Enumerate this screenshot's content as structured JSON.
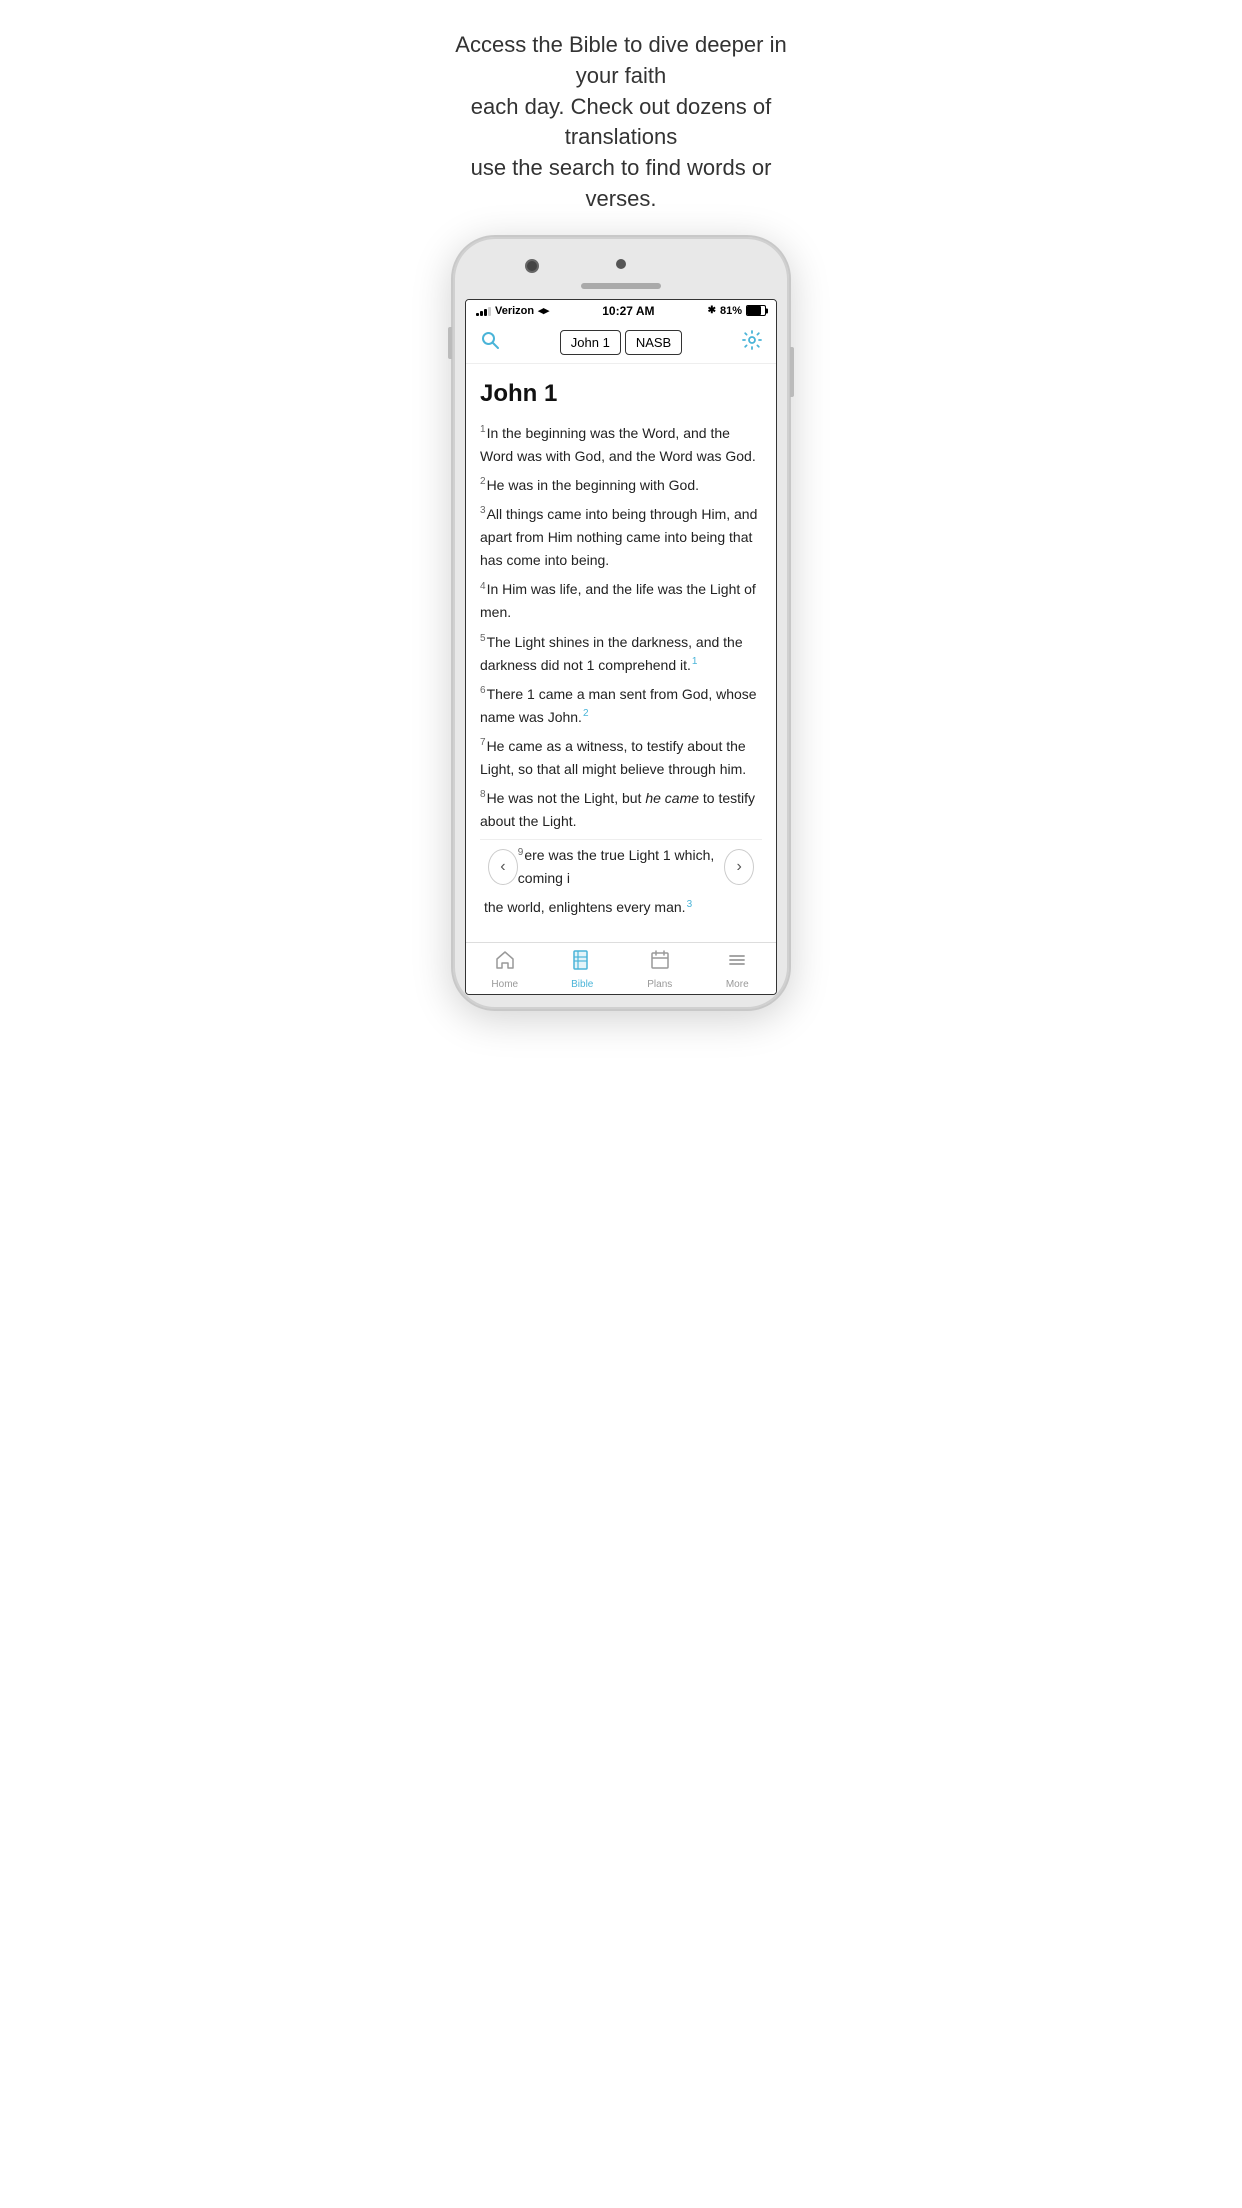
{
  "tagline": {
    "line1": "Access the Bible to dive deeper in your faith",
    "line2": "each day. Check out dozens of translations",
    "line3": "use the search to find words or verses."
  },
  "status_bar": {
    "carrier": "Verizon",
    "time": "10:27 AM",
    "battery_percent": "81%"
  },
  "nav": {
    "chapter": "John 1",
    "translation": "NASB"
  },
  "bible": {
    "chapter_title": "John 1",
    "verses": [
      {
        "num": "1",
        "text": "In the beginning was the Word, and the Word was with God, and the Word was God."
      },
      {
        "num": "2",
        "text": "He was in the beginning with God."
      },
      {
        "num": "3",
        "text": "All things came into being through Him, and apart from Him nothing came into being that has come into being."
      },
      {
        "num": "4",
        "text": "In Him was life, and the life was the Light of men."
      },
      {
        "num": "5",
        "text": "The Light shines in the darkness, and the darkness did not 1 comprehend it.",
        "footnote": "1"
      },
      {
        "num": "6",
        "text": "There 1 came a man sent from God, whose name was John.",
        "footnote": "2"
      },
      {
        "num": "7",
        "text": "He came as a witness, to testify about the Light, so that all might believe through him."
      },
      {
        "num": "8",
        "text": "He was not the Light, but he came to testify about the Light.",
        "italic_part": "he came"
      }
    ],
    "partial_verse_9": "9",
    "partial_text_9": "ere was the true Light 1 which, coming i",
    "partial_text_9b": "the world, enlightens every man.",
    "partial_footnote_9": "3"
  },
  "tab_bar": {
    "tabs": [
      {
        "id": "home",
        "label": "Home",
        "active": false
      },
      {
        "id": "bible",
        "label": "Bible",
        "active": true
      },
      {
        "id": "plans",
        "label": "Plans",
        "active": false
      },
      {
        "id": "more",
        "label": "More",
        "active": false
      }
    ]
  },
  "nav_arrows": {
    "prev": "‹",
    "next": "›"
  }
}
